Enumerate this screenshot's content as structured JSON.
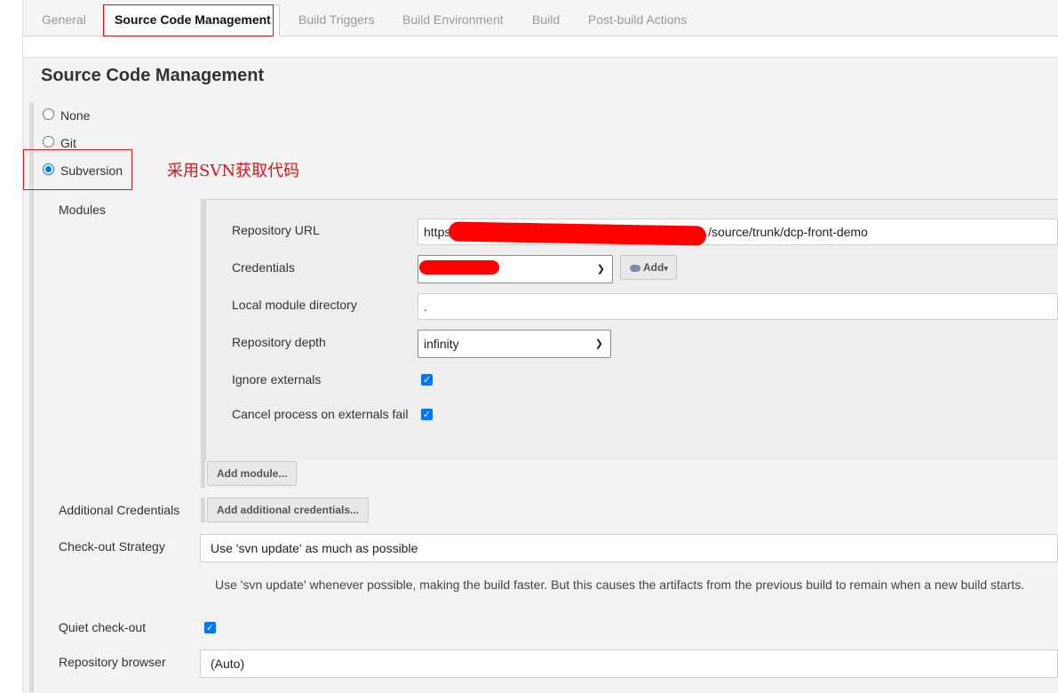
{
  "tabs": [
    "General",
    "Source Code Management",
    "Build Triggers",
    "Build Environment",
    "Build",
    "Post-build Actions"
  ],
  "active_tab": "Source Code Management",
  "section_title": "Source Code Management",
  "scm_options": [
    "None",
    "Git",
    "Subversion"
  ],
  "selected_scm": "Subversion",
  "annotation": "采用SVN获取代码",
  "modules": {
    "label": "Modules",
    "repository_url_label": "Repository URL",
    "repository_url_prefix": "https",
    "repository_url_suffix": "/source/trunk/dcp-front-demo",
    "credentials_label": "Credentials",
    "add_button": "Add",
    "local_dir_label": "Local module directory",
    "local_dir_value": ".",
    "depth_label": "Repository depth",
    "depth_value": "infinity",
    "ignore_externals_label": "Ignore externals",
    "ignore_externals": true,
    "cancel_on_externals_fail_label": "Cancel process on externals fail",
    "cancel_on_externals_fail": true,
    "add_module_button": "Add module..."
  },
  "additional_credentials": {
    "label": "Additional Credentials",
    "button": "Add additional credentials..."
  },
  "checkout_strategy": {
    "label": "Check-out Strategy",
    "value": "Use 'svn update' as much as possible",
    "help": "Use 'svn update' whenever possible, making the build faster. But this causes the artifacts from the previous build to remain when a new build starts."
  },
  "quiet_checkout": {
    "label": "Quiet check-out",
    "checked": true
  },
  "repository_browser": {
    "label": "Repository browser",
    "value": "(Auto)"
  },
  "colors": {
    "accent": "#0075ff",
    "annotation_red": "#e0121a"
  }
}
